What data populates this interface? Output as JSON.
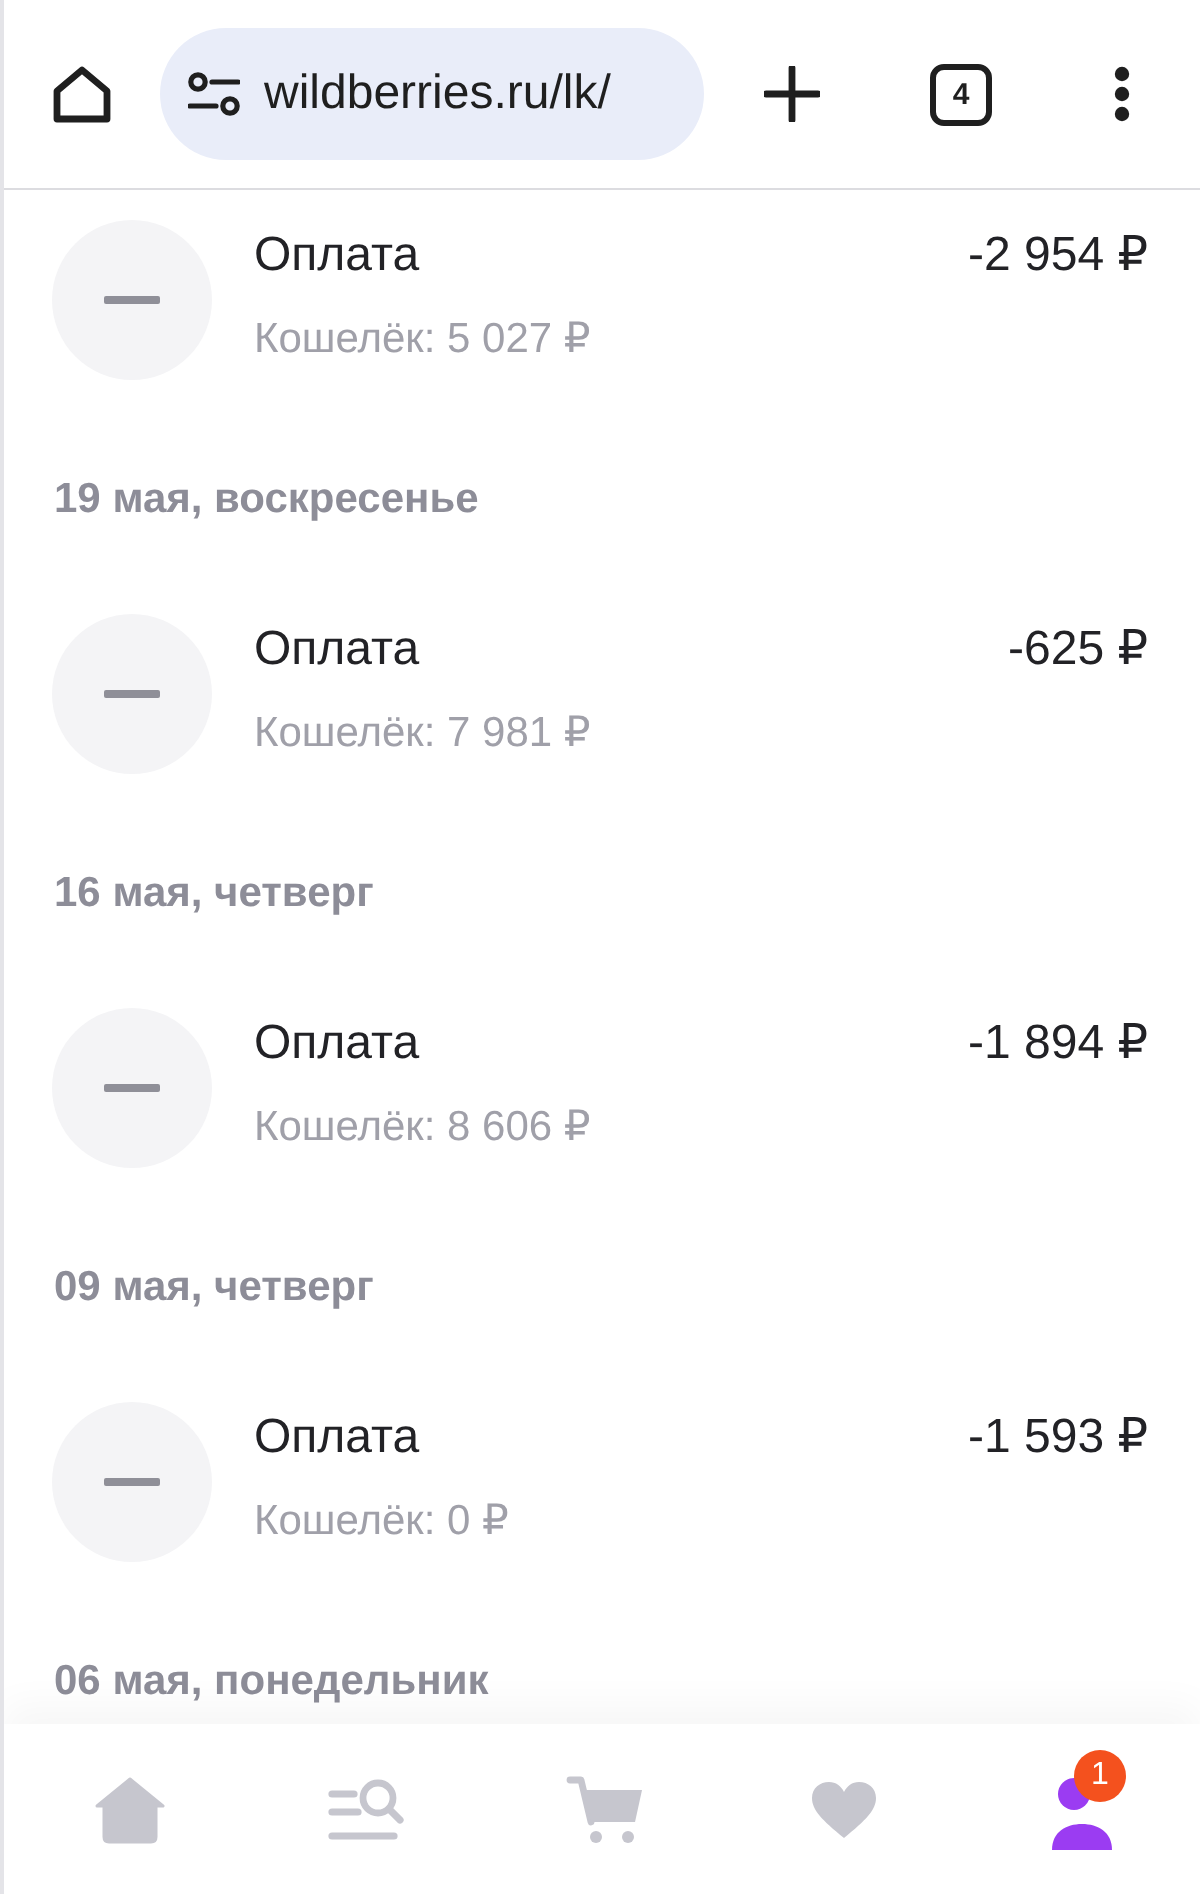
{
  "browser_bar": {
    "url": "wildberries.ru/lk/",
    "tab_count": "4"
  },
  "feed": [
    {
      "kind": "transaction",
      "title": "Оплата",
      "balance": "Кошелёк: 5 027 ₽",
      "amount": "-2 954 ₽"
    },
    {
      "kind": "date",
      "label": "19 мая, воскресенье"
    },
    {
      "kind": "transaction",
      "title": "Оплата",
      "balance": "Кошелёк: 7 981 ₽",
      "amount": "-625 ₽"
    },
    {
      "kind": "date",
      "label": "16 мая, четверг"
    },
    {
      "kind": "transaction",
      "title": "Оплата",
      "balance": "Кошелёк: 8 606 ₽",
      "amount": "-1 894 ₽"
    },
    {
      "kind": "date",
      "label": "09 мая, четверг"
    },
    {
      "kind": "transaction",
      "title": "Оплата",
      "balance": "Кошелёк: 0 ₽",
      "amount": "-1 593 ₽"
    },
    {
      "kind": "date",
      "label": "06 мая, понедельник"
    }
  ],
  "bottom_nav": [
    {
      "kind": "home",
      "selected": false
    },
    {
      "kind": "catalog",
      "selected": false
    },
    {
      "kind": "cart",
      "selected": false
    },
    {
      "kind": "favorites",
      "selected": false
    },
    {
      "kind": "profile",
      "selected": true,
      "badge": "1"
    }
  ]
}
